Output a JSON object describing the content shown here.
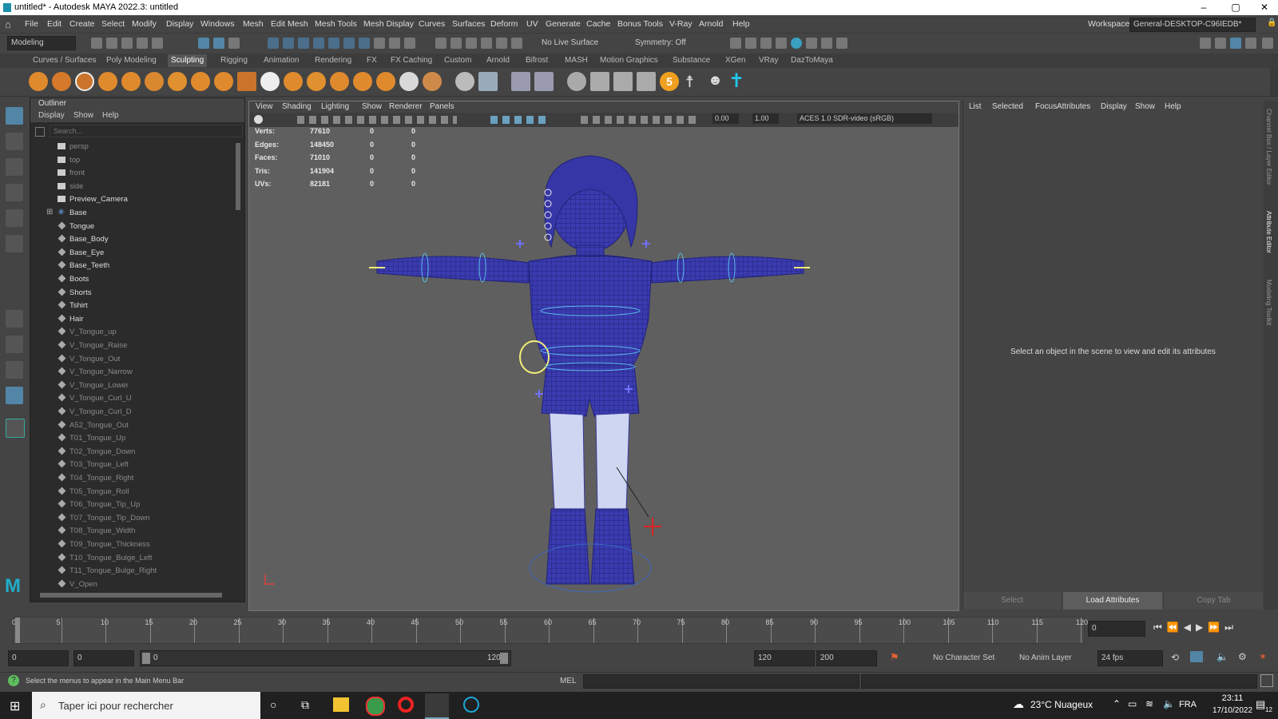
{
  "window": {
    "title": "untitled* - Autodesk MAYA 2022.3: untitled",
    "min": "–",
    "max": "▢",
    "close": "✕"
  },
  "menubar": [
    "File",
    "Edit",
    "Create",
    "Select",
    "Modify",
    "Display",
    "Windows",
    "Mesh",
    "Edit Mesh",
    "Mesh Tools",
    "Mesh Display",
    "Curves",
    "Surfaces",
    "Deform",
    "UV",
    "Generate",
    "Cache",
    "Bonus Tools",
    "V-Ray",
    "Arnold",
    "Help"
  ],
  "workspace": {
    "label": "Workspace:",
    "value": "General-DESKTOP-C96IEDB*"
  },
  "toolbar": {
    "mode": "Modeling",
    "live_surface": "No Live Surface",
    "symmetry": "Symmetry: Off"
  },
  "shelf_tabs": [
    "Curves / Surfaces",
    "Poly Modeling",
    "Sculpting",
    "Rigging",
    "Animation",
    "Rendering",
    "FX",
    "FX Caching",
    "Custom",
    "Arnold",
    "Bifrost",
    "MASH",
    "Motion Graphics",
    "Substance",
    "XGen",
    "VRay",
    "DazToMaya"
  ],
  "shelf_active": "Sculpting",
  "shelf_badge": "5",
  "outliner": {
    "title": "Outliner",
    "menus": [
      "Display",
      "Show",
      "Help"
    ],
    "search_placeholder": "Search...",
    "expand": "⊞",
    "items": [
      {
        "label": "persp",
        "type": "camera",
        "dim": true
      },
      {
        "label": "top",
        "type": "camera",
        "dim": true
      },
      {
        "label": "front",
        "type": "camera",
        "dim": true
      },
      {
        "label": "side",
        "type": "camera",
        "dim": true
      },
      {
        "label": "Preview_Camera",
        "type": "camera",
        "dim": false
      },
      {
        "label": "Base",
        "type": "joint",
        "dim": false
      },
      {
        "label": "Tongue",
        "type": "mesh",
        "dim": false
      },
      {
        "label": "Base_Body",
        "type": "mesh",
        "dim": false
      },
      {
        "label": "Base_Eye",
        "type": "mesh",
        "dim": false
      },
      {
        "label": "Base_Teeth",
        "type": "mesh",
        "dim": false
      },
      {
        "label": "Boots",
        "type": "mesh",
        "dim": false
      },
      {
        "label": "Shorts",
        "type": "mesh",
        "dim": false
      },
      {
        "label": "Tshirt",
        "type": "mesh",
        "dim": false
      },
      {
        "label": "Hair",
        "type": "mesh",
        "dim": false
      },
      {
        "label": "V_Tongue_up",
        "type": "mesh",
        "dim": true
      },
      {
        "label": "V_Tongue_Raise",
        "type": "mesh",
        "dim": true
      },
      {
        "label": "V_Tongue_Out",
        "type": "mesh",
        "dim": true
      },
      {
        "label": "V_Tongue_Narrow",
        "type": "mesh",
        "dim": true
      },
      {
        "label": "V_Tongue_Lower",
        "type": "mesh",
        "dim": true
      },
      {
        "label": "V_Tongue_Curl_U",
        "type": "mesh",
        "dim": true
      },
      {
        "label": "V_Tongue_Curl_D",
        "type": "mesh",
        "dim": true
      },
      {
        "label": "A52_Tongue_Out",
        "type": "mesh",
        "dim": true
      },
      {
        "label": "T01_Tongue_Up",
        "type": "mesh",
        "dim": true
      },
      {
        "label": "T02_Tongue_Down",
        "type": "mesh",
        "dim": true
      },
      {
        "label": "T03_Tongue_Left",
        "type": "mesh",
        "dim": true
      },
      {
        "label": "T04_Tongue_Right",
        "type": "mesh",
        "dim": true
      },
      {
        "label": "T05_Tongue_Roll",
        "type": "mesh",
        "dim": true
      },
      {
        "label": "T06_Tongue_Tip_Up",
        "type": "mesh",
        "dim": true
      },
      {
        "label": "T07_Tongue_Tip_Down",
        "type": "mesh",
        "dim": true
      },
      {
        "label": "T08_Tongue_Width",
        "type": "mesh",
        "dim": true
      },
      {
        "label": "T09_Tongue_Thickness",
        "type": "mesh",
        "dim": true
      },
      {
        "label": "T10_Tongue_Bulge_Left",
        "type": "mesh",
        "dim": true
      },
      {
        "label": "T11_Tongue_Bulge_Right",
        "type": "mesh",
        "dim": true
      },
      {
        "label": "V_Open",
        "type": "mesh",
        "dim": true
      }
    ]
  },
  "viewport": {
    "menus": [
      "View",
      "Shading",
      "Lighting",
      "Show",
      "Renderer",
      "Panels"
    ],
    "field_a": "0.00",
    "field_b": "1.00",
    "color_space": "ACES 1.0 SDR-video (sRGB)",
    "hud": [
      {
        "label": "Verts:",
        "a": "77610",
        "b": "0",
        "c": "0"
      },
      {
        "label": "Edges:",
        "a": "148450",
        "b": "0",
        "c": "0"
      },
      {
        "label": "Faces:",
        "a": "71010",
        "b": "0",
        "c": "0"
      },
      {
        "label": "Tris:",
        "a": "141904",
        "b": "0",
        "c": "0"
      },
      {
        "label": "UVs:",
        "a": "82181",
        "b": "0",
        "c": "0"
      }
    ]
  },
  "attribute_editor": {
    "menus": [
      "List",
      "Selected",
      "Focus",
      "Attributes",
      "Display",
      "Show",
      "Help"
    ],
    "message": "Select an object in the scene to view and edit its attributes",
    "buttons": [
      "Select",
      "Load Attributes",
      "Copy Tab"
    ],
    "side_tabs": [
      "Channel Box / Layer Editor",
      "Attribute Editor",
      "Modeling Toolkit"
    ]
  },
  "timeline": {
    "ticks": [
      "0",
      "5",
      "10",
      "15",
      "20",
      "25",
      "30",
      "35",
      "40",
      "45",
      "50",
      "55",
      "60",
      "65",
      "70",
      "75",
      "80",
      "85",
      "90",
      "95",
      "100",
      "105",
      "110",
      "115",
      "120"
    ],
    "current": "0"
  },
  "range": {
    "start": "0",
    "anim_start": "0",
    "slider_start": "0",
    "slider_end": "120",
    "end": "120",
    "anim_end": "200",
    "character_set": "No Character Set",
    "anim_layer": "No Anim Layer",
    "fps": "24 fps"
  },
  "helpline": {
    "text": "Select the menus to appear in the Main Menu Bar",
    "mel": "MEL"
  },
  "taskbar": {
    "search": "Taper ici pour rechercher",
    "weather": "23°C  Nuageux",
    "lang": "FRA",
    "time": "23:11",
    "date": "17/10/2022",
    "notif": "12"
  },
  "colors": {
    "accent": "#5285a6",
    "wire": "#2a2a9a",
    "selected_tab": "#555555"
  }
}
